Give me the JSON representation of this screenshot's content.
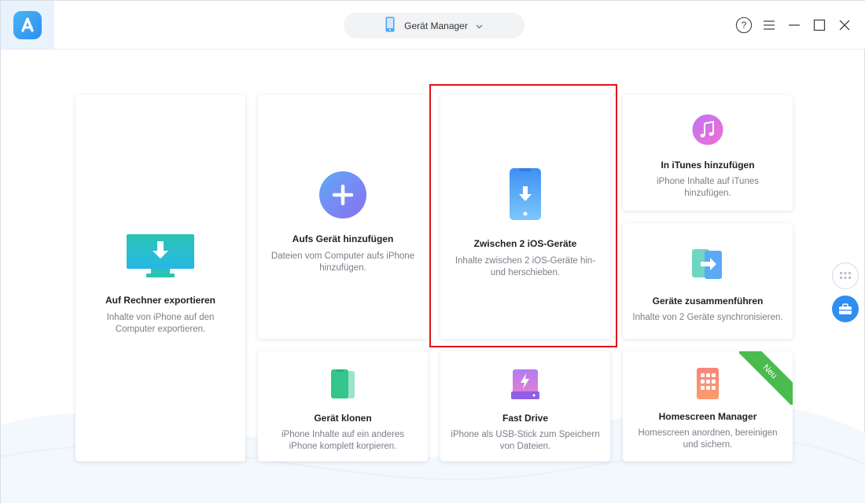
{
  "header": {
    "device_selector_label": "Gerät Manager"
  },
  "cards": {
    "export": {
      "title": "Auf Rechner exportieren",
      "desc_line1": "Inhalte von iPhone auf den",
      "desc_line2": "Computer exportieren."
    },
    "add": {
      "title": "Aufs Gerät hinzufügen",
      "desc_line1": "Dateien vom Computer aufs iPhone",
      "desc_line2": "hinzufügen."
    },
    "transfer": {
      "title": "Zwischen 2 iOS-Geräte",
      "desc_line1": "Inhalte zwischen 2 iOS-Geräte hin-",
      "desc_line2": "und herschieben."
    },
    "itunes": {
      "title": "In iTunes hinzufügen",
      "desc_line1": "iPhone Inhalte auf iTunes",
      "desc_line2": "hinzufügen."
    },
    "merge": {
      "title": "Geräte zusammenführen",
      "desc_line1": "Inhalte von 2 Geräte synchronisieren."
    },
    "clone": {
      "title": "Gerät klonen",
      "desc_line1": "iPhone Inhalte auf ein anderes",
      "desc_line2": "iPhone komplett korpieren."
    },
    "fastdrive": {
      "title": "Fast Drive",
      "desc_line1": "iPhone als USB-Stick zum Speichern",
      "desc_line2": "von Dateien."
    },
    "homescreen": {
      "title": "Homescreen Manager",
      "desc_line1": "Homescreen anordnen, bereinigen",
      "desc_line2": "und sichern.",
      "badge": "Neu"
    }
  },
  "icons": {
    "logo": "app-logo-icon",
    "selector": "iphone-icon",
    "help": "help-icon",
    "menu": "menu-icon",
    "minimize": "minimize-icon",
    "maximize": "maximize-icon",
    "close": "close-icon"
  },
  "colors": {
    "accent": "#2f8ef0",
    "highlight": "#e0131a",
    "badge": "#4cbb4f"
  }
}
